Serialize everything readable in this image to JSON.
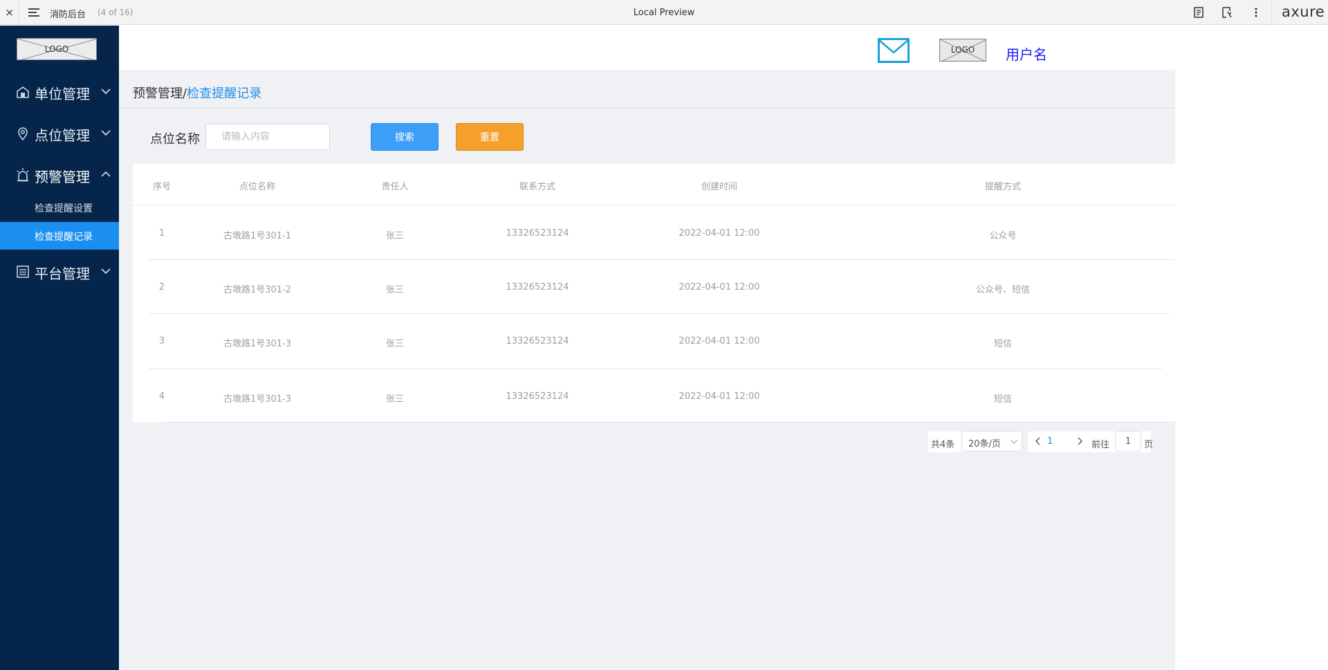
{
  "topbar": {
    "close_glyph": "×",
    "title": "消防后台",
    "page_count": "(4 of 16)",
    "preview_label": "Local Preview",
    "brand": "axure",
    "icons": [
      "close-icon",
      "menu-icon",
      "notes-icon",
      "inspect-icon",
      "more-icon"
    ]
  },
  "sidebar": {
    "logo_text": "LOGO",
    "items": [
      {
        "label": "单位管理",
        "icon": "building-icon",
        "expanded": false
      },
      {
        "label": "点位管理",
        "icon": "location-pin-icon",
        "expanded": false
      },
      {
        "label": "预警管理",
        "icon": "alarm-icon",
        "expanded": true
      },
      {
        "label": "平台管理",
        "icon": "list-icon",
        "expanded": false
      }
    ],
    "subitems": [
      {
        "label": "检查提醒设置",
        "active": false
      },
      {
        "label": "检查提醒记录",
        "active": true
      }
    ],
    "colors": {
      "background": "#05254a",
      "active": "#1b8ff0"
    }
  },
  "header": {
    "logo_text": "LOGO",
    "username": "用户名",
    "mail_icon": "mail-icon"
  },
  "breadcrumb": {
    "parent": "预警管理",
    "separator": "/",
    "current": "检查提醒记录"
  },
  "filter": {
    "label": "点位名称",
    "placeholder": "请输入内容",
    "value": "",
    "search_label": "搜索",
    "reset_label": "重置"
  },
  "table": {
    "columns": [
      "序号",
      "点位名称",
      "责任人",
      "联系方式",
      "创建时间",
      "提醒方式"
    ],
    "rows": [
      [
        "1",
        "古墩路1号301-1",
        "张三",
        "13326523124",
        "2022-04-01 12:00",
        "公众号"
      ],
      [
        "2",
        "古墩路1号301-2",
        "张三",
        "13326523124",
        "2022-04-01 12:00",
        "公众号、短信"
      ],
      [
        "3",
        "古墩路1号301-3",
        "张三",
        "13326523124",
        "2022-04-01 12:00",
        "短信"
      ],
      [
        "4",
        "古墩路1号301-3",
        "张三",
        "13326523124",
        "2022-04-01 12:00",
        "短信"
      ]
    ]
  },
  "pagination": {
    "total": "共4条",
    "page_size": "20条/页",
    "current_page": "1",
    "goto_label": "前往",
    "goto_value": "1",
    "page_suffix": "页"
  },
  "colors": {
    "accent": "#1e90e8",
    "search_button": "#3c9ef7",
    "reset_button": "#f5a02a",
    "username": "#1a1aff",
    "mail_icon": "#1aa0e0"
  }
}
